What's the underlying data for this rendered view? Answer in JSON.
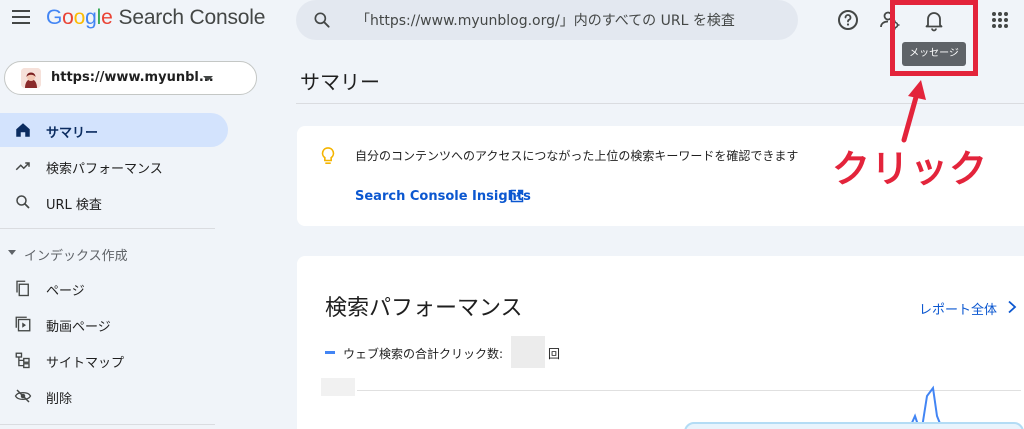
{
  "header": {
    "logo_letters": [
      "G",
      "o",
      "o",
      "g",
      "l",
      "e"
    ],
    "product": "Search Console",
    "search_placeholder": "「https://www.myunblog.org/」内のすべての URL を検査",
    "tooltip": "メッセージ"
  },
  "sidebar": {
    "property": "https://www.myunbl...",
    "items": [
      {
        "label": "サマリー",
        "icon": "home-icon",
        "active": true
      },
      {
        "label": "検索パフォーマンス",
        "icon": "trending-up-icon"
      },
      {
        "label": "URL 検査",
        "icon": "search-icon"
      }
    ],
    "section_label": "インデックス作成",
    "index_items": [
      {
        "label": "ページ",
        "icon": "pages-icon"
      },
      {
        "label": "動画ページ",
        "icon": "video-pages-icon"
      },
      {
        "label": "サイトマップ",
        "icon": "sitemap-icon"
      },
      {
        "label": "削除",
        "icon": "removals-icon"
      }
    ]
  },
  "main": {
    "page_title": "サマリー",
    "insights_card": {
      "text": "自分のコンテンツへのアクセスにつながった上位の検索キーワードを確認できます",
      "link": "Search Console Insights"
    },
    "performance_card": {
      "title": "検索パフォーマンス",
      "report_link": "レポート全体",
      "legend_label": "ウェブ検索の合計クリック数:",
      "unit": "回"
    }
  },
  "annotation": {
    "text": "クリック",
    "color": "#e3243b"
  },
  "colors": {
    "accent": "#0b57d0",
    "active_nav": "#d3e3fd",
    "background": "#f0f4f9",
    "series": "#4285f4"
  }
}
